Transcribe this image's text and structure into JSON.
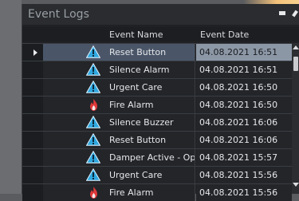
{
  "window": {
    "title": "Event Logs"
  },
  "table": {
    "columns": [
      "",
      "",
      "Event Name",
      "Event Date"
    ],
    "rows": [
      {
        "icon": "warning-triangle-icon",
        "name": "Reset Button",
        "date": "04.08.2021 16:51",
        "selected": true
      },
      {
        "icon": "warning-triangle-icon",
        "name": "Silence Alarm",
        "date": "04.08.2021 16:51",
        "selected": false
      },
      {
        "icon": "warning-triangle-icon",
        "name": "Urgent Care",
        "date": "04.08.2021 16:50",
        "selected": false
      },
      {
        "icon": "fire-icon",
        "name": "Fire Alarm",
        "date": "04.08.2021 16:50",
        "selected": false
      },
      {
        "icon": "warning-triangle-icon",
        "name": "Silence Buzzer",
        "date": "04.08.2021 16:06",
        "selected": false
      },
      {
        "icon": "warning-triangle-icon",
        "name": "Reset Button",
        "date": "04.08.2021 16:06",
        "selected": false
      },
      {
        "icon": "warning-triangle-icon",
        "name": "Damper Active - Open",
        "date": "04.08.2021 15:57",
        "selected": false
      },
      {
        "icon": "warning-triangle-icon",
        "name": "Urgent Care",
        "date": "04.08.2021 15:56",
        "selected": false
      },
      {
        "icon": "fire-icon",
        "name": "Fire Alarm",
        "date": "04.08.2021 15:56",
        "selected": false
      }
    ]
  },
  "colors": {
    "warning_icon": "#2fa8e0",
    "fire_icon": "#e0393a",
    "selected_row": "#4a5668",
    "selected_date": "#8c97a6"
  }
}
